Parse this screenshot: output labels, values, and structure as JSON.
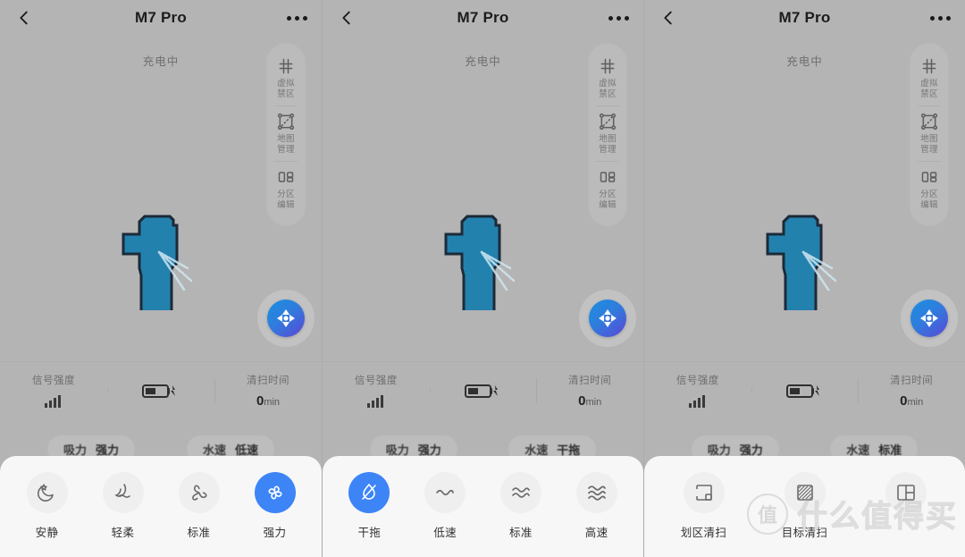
{
  "header": {
    "title": "M7 Pro",
    "back_icon": "chevron-left-icon",
    "menu_icon": "more-options-icon"
  },
  "status": {
    "text": "充电中"
  },
  "rail": {
    "items": [
      {
        "icon": "no-go-zone-icon",
        "label_line1": "虚拟",
        "label_line2": "禁区"
      },
      {
        "icon": "map-manage-icon",
        "label_line1": "地图",
        "label_line2": "管理"
      },
      {
        "icon": "zone-edit-icon",
        "label_line1": "分区",
        "label_line2": "编辑"
      }
    ]
  },
  "joystick": {
    "icon": "dpad-remote-icon"
  },
  "stats": {
    "signal": {
      "label": "信号强度",
      "icon": "signal-bars-icon"
    },
    "battery": {
      "icon": "battery-charging-icon"
    },
    "time": {
      "label": "清扫时间",
      "value": "0",
      "unit": "min"
    }
  },
  "map": {
    "fill_color": "#2381ae",
    "outline_color": "#1d2a38"
  },
  "colors": {
    "background": "#b4b4b4",
    "accent": "#3d84f7",
    "sheet": "#f7f7f7",
    "rail_text": "#767676"
  },
  "panels": [
    {
      "pills": [
        {
          "key": "吸力",
          "value": "强力"
        },
        {
          "key": "水速",
          "value": "低速"
        }
      ],
      "sheet": {
        "name": "suction-options",
        "options": [
          {
            "icon": "moon-star-icon",
            "label": "安静",
            "selected": false
          },
          {
            "icon": "feather-wave-icon",
            "label": "轻柔",
            "selected": false
          },
          {
            "icon": "fan-blade-icon",
            "label": "标准",
            "selected": false
          },
          {
            "icon": "pinwheel-icon",
            "label": "强力",
            "selected": true
          }
        ]
      }
    },
    {
      "pills": [
        {
          "key": "吸力",
          "value": "强力"
        },
        {
          "key": "水速",
          "value": "干拖"
        }
      ],
      "sheet": {
        "name": "water-level-options",
        "options": [
          {
            "icon": "droplet-off-icon",
            "label": "干拖",
            "selected": true
          },
          {
            "icon": "wave-single-icon",
            "label": "低速",
            "selected": false
          },
          {
            "icon": "wave-double-icon",
            "label": "标准",
            "selected": false
          },
          {
            "icon": "wave-triple-icon",
            "label": "高速",
            "selected": false
          }
        ]
      }
    },
    {
      "pills": [
        {
          "key": "吸力",
          "value": "强力"
        },
        {
          "key": "水速",
          "value": "标准"
        }
      ],
      "sheet": {
        "name": "clean-mode-options",
        "options": [
          {
            "icon": "zone-clean-icon",
            "label": "划区清扫",
            "selected": false
          },
          {
            "icon": "target-clean-icon",
            "label": "目标清扫",
            "selected": false
          },
          {
            "icon": "room-split-icon",
            "label": "",
            "selected": false
          }
        ]
      }
    }
  ],
  "watermark": {
    "badge": "值",
    "text": "什么值得买"
  }
}
